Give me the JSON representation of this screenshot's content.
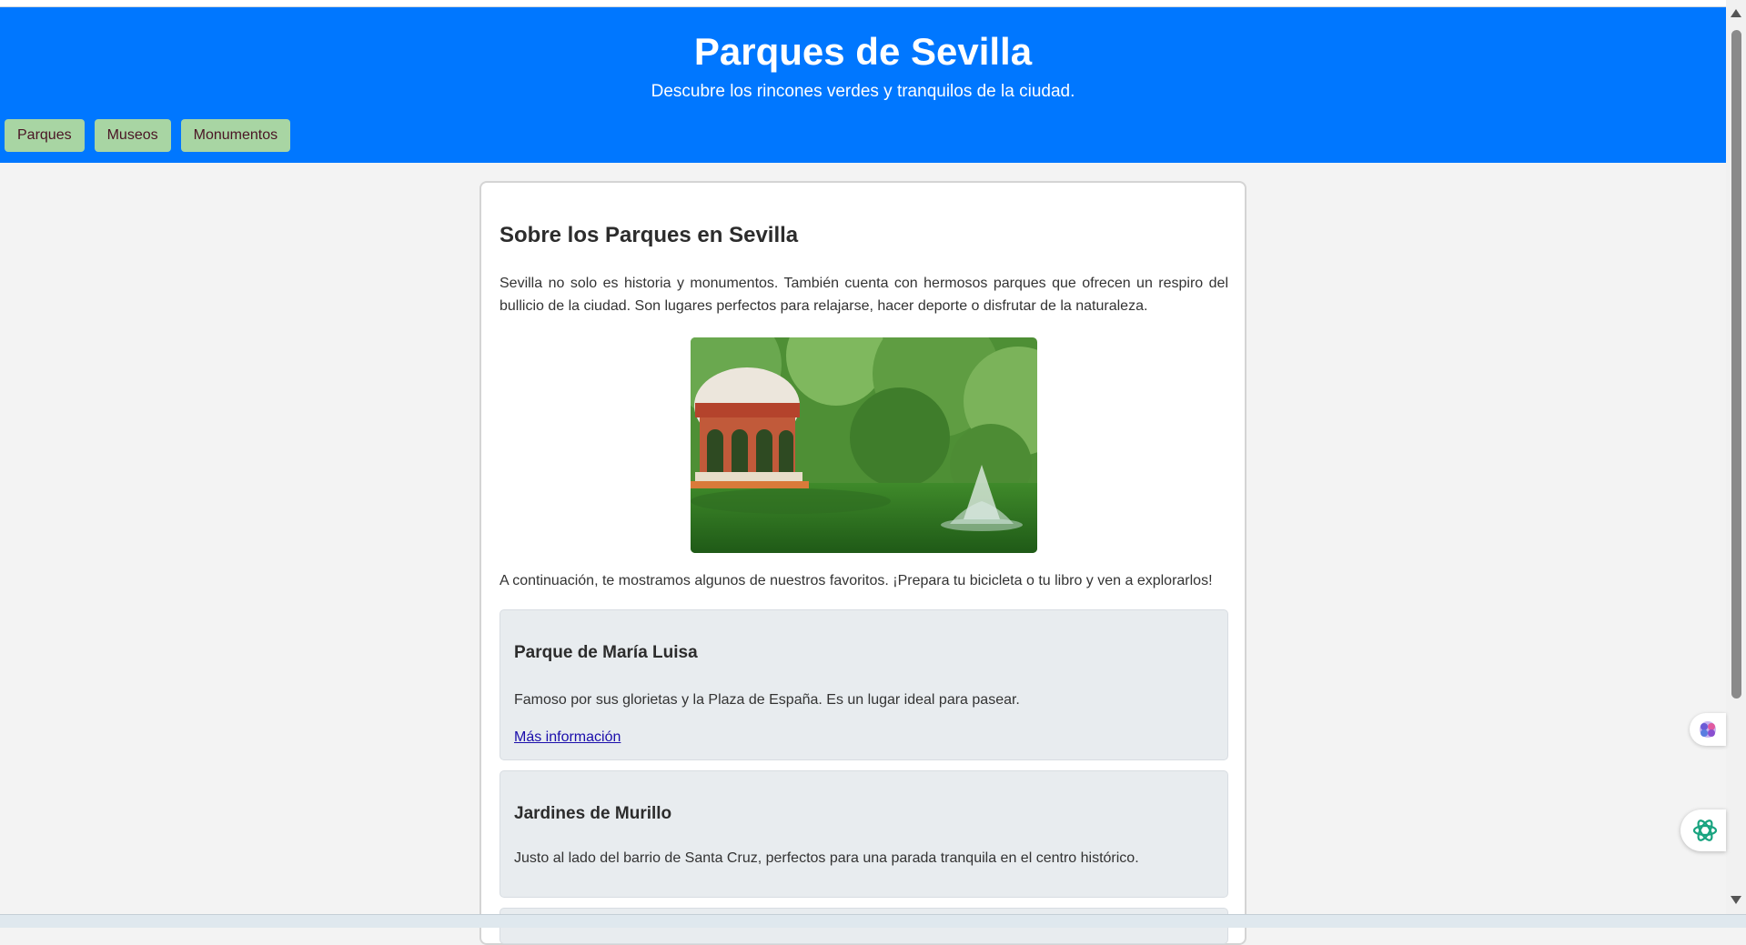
{
  "header": {
    "title": "Parques de Sevilla",
    "subtitle": "Descubre los rincones verdes y tranquilos de la ciudad."
  },
  "nav": {
    "items": [
      {
        "label": "Parques"
      },
      {
        "label": "Museos"
      },
      {
        "label": "Monumentos"
      }
    ]
  },
  "main": {
    "heading": "Sobre los Parques en Sevilla",
    "intro": "Sevilla no solo es historia y monumentos. También cuenta con hermosos parques que ofrecen un respiro del bullicio de la ciudad. Son lugares perfectos para relajarse, hacer deporte o disfrutar de la naturaleza.",
    "lead": "A continuación, te mostramos algunos de nuestros favoritos. ¡Prepara tu bicicleta o tu libro y ven a explorarlos!",
    "parks": [
      {
        "name": "Parque de María Luisa",
        "description": "Famoso por sus glorietas y la Plaza de España. Es un lugar ideal para pasear.",
        "link": "Más información"
      },
      {
        "name": "Jardines de Murillo",
        "description": "Justo al lado del barrio de Santa Cruz, perfectos para una parada tranquila en el centro histórico."
      }
    ]
  },
  "colors": {
    "header_bg": "#0077ff",
    "nav_button_bg": "#a8d5a3",
    "nav_button_text": "#4a1424",
    "park_card_bg": "#e8ecef",
    "link": "#1a0dab"
  },
  "floating_icons": [
    "brain-icon",
    "chatgpt-icon"
  ]
}
